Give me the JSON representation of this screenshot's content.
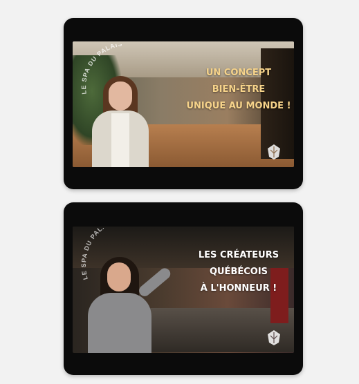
{
  "videos": [
    {
      "arc_text": "LE SPA DU PALAIS",
      "headline": [
        "UN CONCEPT",
        "BIEN-ÊTRE",
        "UNIQUE AU MONDE !"
      ],
      "accent": "#f6d38a"
    },
    {
      "arc_text": "LE SPA DU PALAIS",
      "headline": [
        "LES CRÉATEURS",
        "QUÉBÉCOIS",
        "À L'HONNEUR !"
      ],
      "accent": "#ffffff"
    }
  ]
}
